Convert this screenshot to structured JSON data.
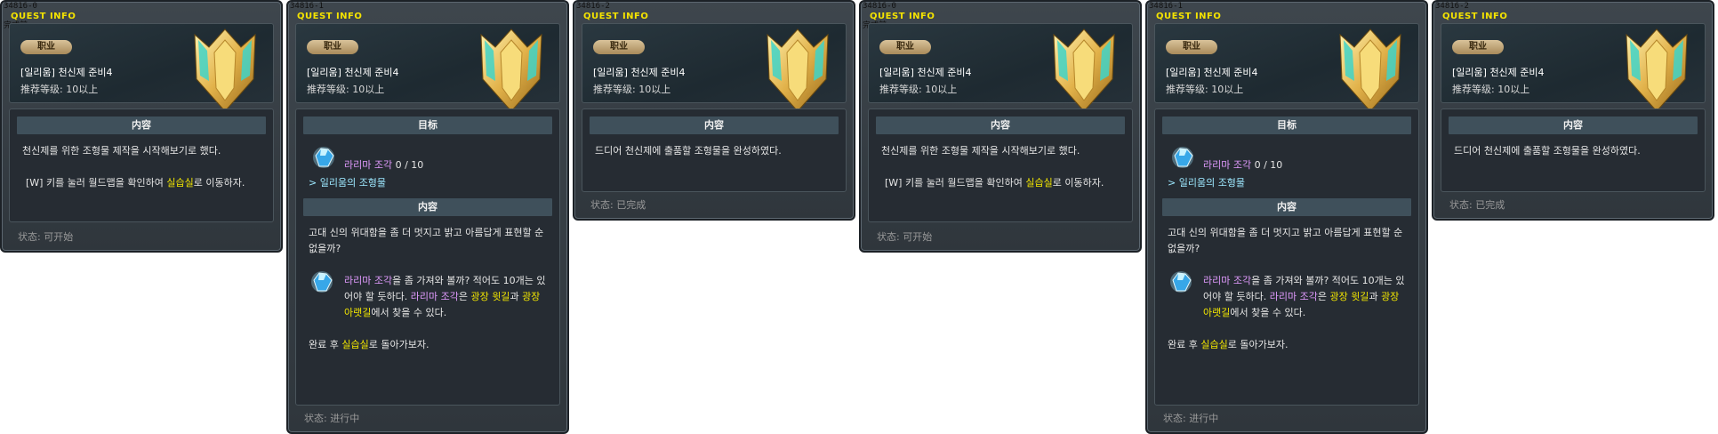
{
  "panels": [
    {
      "id": "34816-0",
      "subtag": "完成前",
      "header_label": "QUEST INFO",
      "job_badge": "职业",
      "quest_name": "[일리움] 천신제 준비4",
      "level_text": "推荐等级: 10以上",
      "sections": [
        {
          "title": "内容"
        }
      ],
      "content_lines": [
        "천신제를 위한 조형물 제작을 시작해보기로 했다.",
        "[W] 키를 눌러 월드맵을 확인하여 ",
        "실습실",
        "로 이동하자."
      ],
      "status": "状态: 可开始"
    },
    {
      "id": "34816-1",
      "header_label": "QUEST INFO",
      "job_badge": "职业",
      "quest_name": "[일리움] 천신제 준비4",
      "level_text": "推荐等级: 10以上",
      "goal_title": "目标",
      "objective": {
        "item": "라리마 조각",
        "count": "0 / 10",
        "location": "> 일리움의 조형물"
      },
      "content_title": "内容",
      "content": {
        "line1": "고대 신의 위대함을 좀 더 멋지고 밝고 아름답게 표현할 순 없을까?",
        "item": "라리마 조각",
        "line2a": "을 좀 가져와 볼까? 적어도 10개는 있어야 할 듯하다. ",
        "item2": "라리마 조각",
        "line2b": "은 ",
        "loc1": "광장 윗길",
        "line2c": "과 ",
        "loc2": "광장 아랫길",
        "line2d": "에서 찾을 수 있다.",
        "line3a": "완료 후 ",
        "place": "실습실",
        "line3b": "로 돌아가보자."
      },
      "status": "状态: 进行中"
    },
    {
      "id": "34816-2",
      "header_label": "QUEST INFO",
      "job_badge": "职业",
      "quest_name": "[일리움] 천신제 준비4",
      "level_text": "推荐等级: 10以上",
      "content_title": "内容",
      "content_line": "드디어 천신제에 출품할 조형물을 완성하였다.",
      "status": "状态: 已完成"
    }
  ],
  "colors": {
    "title_yellow": "#f4e300",
    "item_purple": "#e29bff",
    "loc_cyan": "#9de8ff"
  }
}
